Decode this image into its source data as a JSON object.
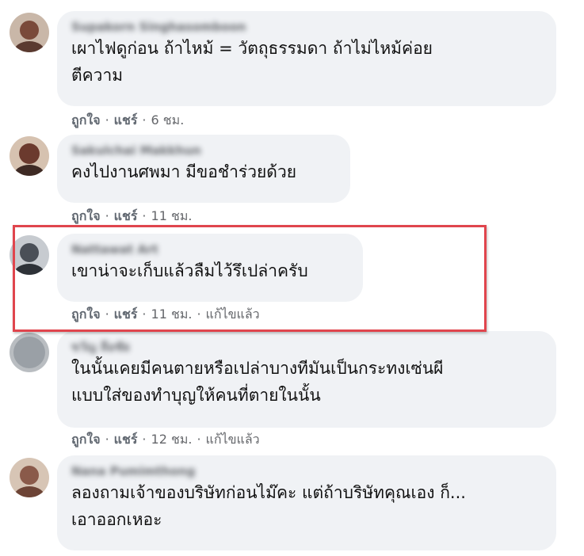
{
  "comments": [
    {
      "author": "Supakorn Singhasomboon",
      "text": "เผาไฟดูก่อน ถ้าไหม้ = วัตถุธรรมดา ถ้าไม่ไหม้ค่อย\nตีความ",
      "like_label": "ถูกใจ",
      "share_label": "แชร์",
      "time": "6 ชม.",
      "edited": ""
    },
    {
      "author": "Sakulchai Makkhun",
      "text": "คงไปงานศพมา มีขอชำร่วยด้วย",
      "like_label": "ถูกใจ",
      "share_label": "แชร์",
      "time": "11 ชม.",
      "edited": ""
    },
    {
      "author": "Nattawat Art",
      "text": "เขาน่าจะเก็บแล้วลืมไว้รึเปล่าครับ",
      "like_label": "ถูกใจ",
      "share_label": "แชร์",
      "time": "11 ชม.",
      "edited": "แก้ไขแล้ว"
    },
    {
      "author": "ขวัญ ลือชัย",
      "text": "ในนั้นเคยมีคนตายหรือเปล่าบางทีมันเป็นกระทงเซ่นผี\nแบบใส่ของทำบุญให้คนที่ตายในนั้น",
      "like_label": "ถูกใจ",
      "share_label": "แชร์",
      "time": "12 ชม.",
      "edited": "แก้ไขแล้ว"
    },
    {
      "author": "Nana Pumimthong",
      "text": "ลองถามเจ้าของบริษัทก่อนไม๊คะ แต่ถ้าบริษัทคุณเอง ก็...\nเอาออกเหอะ",
      "like_label": "",
      "share_label": "",
      "time": "",
      "edited": ""
    }
  ],
  "avatar_colors": [
    "#7a4a3a",
    "#6b3a2e",
    "#4a4f57",
    "#9aa0a6",
    "#8a5a4a"
  ],
  "highlight_color": "#e0454d",
  "action_separator": "·"
}
